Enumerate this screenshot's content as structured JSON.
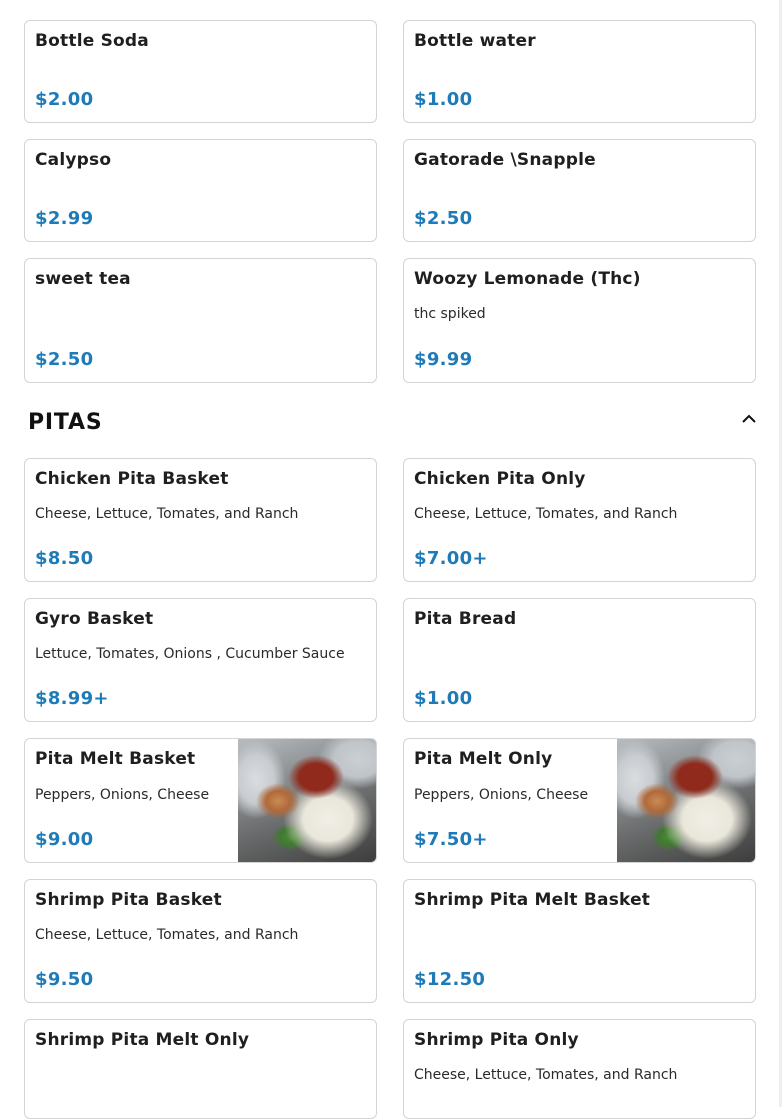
{
  "items_top": [
    {
      "name": "Bottle Soda",
      "desc": "",
      "price": "$2.00"
    },
    {
      "name": "Bottle water",
      "desc": "",
      "price": "$1.00"
    },
    {
      "name": "Calypso",
      "desc": "",
      "price": "$2.99"
    },
    {
      "name": "Gatorade \\Snapple",
      "desc": "",
      "price": "$2.50"
    },
    {
      "name": "sweet tea",
      "desc": "",
      "price": "$2.50"
    },
    {
      "name": "Woozy Lemonade (Thc)",
      "desc": "thc spiked",
      "price": "$9.99"
    }
  ],
  "pitas": {
    "title": "PITAS",
    "toggle_icon": "chevron-up-icon",
    "items": [
      {
        "name": "Chicken Pita Basket",
        "desc": "Cheese, Lettuce, Tomates, and Ranch",
        "price": "$8.50"
      },
      {
        "name": "Chicken Pita Only",
        "desc": "Cheese, Lettuce, Tomates, and Ranch",
        "price": "$7.00+"
      },
      {
        "name": "Gyro Basket",
        "desc": "Lettuce, Tomates, Onions , Cucumber Sauce",
        "price": "$8.99+"
      },
      {
        "name": "Pita Bread",
        "desc": "",
        "price": "$1.00"
      },
      {
        "name": "Pita Melt Basket",
        "desc": "Peppers, Onions, Cheese",
        "price": "$9.00",
        "image": "pita-melt-photo"
      },
      {
        "name": "Pita Melt Only",
        "desc": "Peppers, Onions, Cheese",
        "price": "$7.50+",
        "image": "pita-melt-photo"
      },
      {
        "name": "Shrimp Pita Basket",
        "desc": "Cheese, Lettuce, Tomates, and Ranch",
        "price": "$9.50"
      },
      {
        "name": "Shrimp Pita Melt Basket",
        "desc": "",
        "price": "$12.50"
      },
      {
        "name": "Shrimp Pita Melt Only",
        "desc": "",
        "price": ""
      },
      {
        "name": "Shrimp Pita Only",
        "desc": "Cheese, Lettuce, Tomates, and Ranch",
        "price": ""
      }
    ]
  },
  "colors": {
    "price": "#1f7ab8",
    "border": "#d4d4d4"
  }
}
